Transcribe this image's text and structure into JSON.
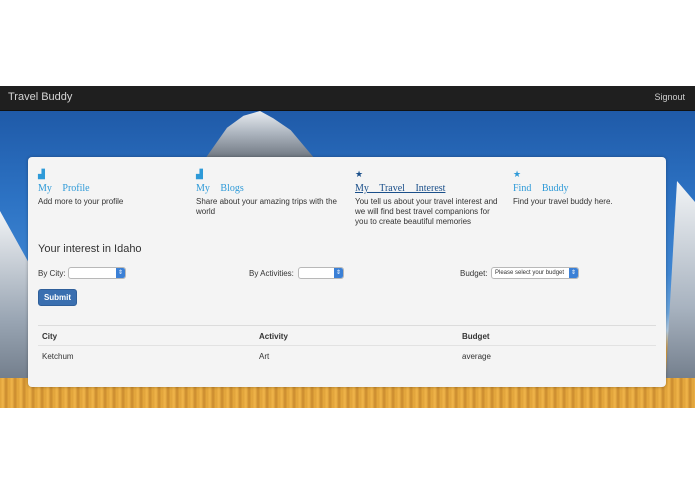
{
  "navbar": {
    "brand": "Travel Buddy",
    "signout": "Signout"
  },
  "features": [
    {
      "icon": "bar-chart-icon",
      "glyph": "▟",
      "title": "My Profile",
      "desc": "Add more to your profile",
      "active": false
    },
    {
      "icon": "bar-chart-icon",
      "glyph": "▟",
      "title": "My Blogs",
      "desc": "Share about your amazing trips with the world",
      "active": false
    },
    {
      "icon": "star-icon",
      "glyph": "★",
      "title": "My Travel Interest",
      "desc": "You tell us about your travel interest and we will find best travel companions for you to create beautiful memories",
      "active": true
    },
    {
      "icon": "star-icon",
      "glyph": "★",
      "title": "Find Buddy",
      "desc": "Find your travel buddy here.",
      "active": false
    }
  ],
  "interest": {
    "title": "Your interest in Idaho",
    "city_label": "By City:",
    "city_value": "",
    "activity_label": "By Activities:",
    "activity_value": "",
    "budget_label": "Budget:",
    "budget_value": "Please select your budget",
    "submit_label": "Submit"
  },
  "table": {
    "headers": [
      "City",
      "Activity",
      "Budget"
    ],
    "rows": [
      [
        "Ketchum",
        "Art",
        "average"
      ]
    ]
  },
  "colors": {
    "navbar": "#1f1f1f",
    "accent": "#2e9ad8",
    "active_link": "#1a4f8a",
    "submit": "#3a6fb0"
  }
}
